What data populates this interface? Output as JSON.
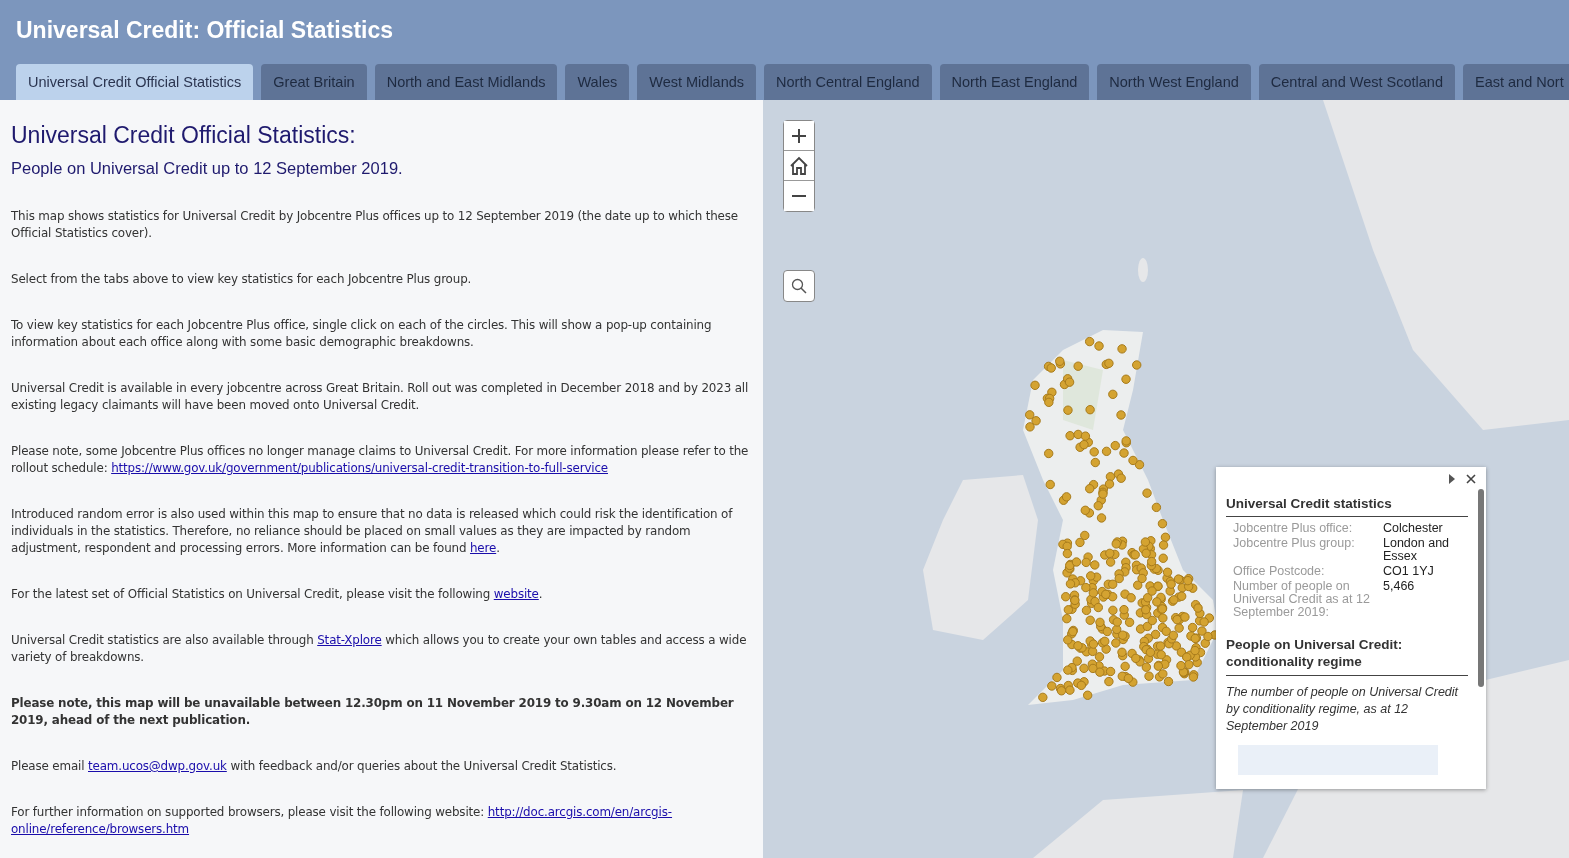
{
  "header": {
    "title": "Universal Credit: Official Statistics"
  },
  "tabs": [
    {
      "label": "Universal Credit Official Statistics",
      "selected": true
    },
    {
      "label": "Great Britain",
      "selected": false
    },
    {
      "label": "North and East Midlands",
      "selected": false
    },
    {
      "label": "Wales",
      "selected": false
    },
    {
      "label": "West Midlands",
      "selected": false
    },
    {
      "label": "North Central England",
      "selected": false
    },
    {
      "label": "North East England",
      "selected": false
    },
    {
      "label": "North West England",
      "selected": false
    },
    {
      "label": "Central and West Scotland",
      "selected": false
    },
    {
      "label": "East and Nort",
      "selected": false
    }
  ],
  "panel": {
    "heading": "Universal Credit Official Statistics:",
    "subheading": "People on Universal Credit up to 12 September 2019.",
    "paragraphs": [
      {
        "bold": false,
        "parts": [
          {
            "kind": "text",
            "text": "This map shows statistics for Universal Credit by Jobcentre Plus offices up to 12 September 2019 (the date up to which these Official Statistics cover)."
          }
        ]
      },
      {
        "bold": false,
        "parts": [
          {
            "kind": "text",
            "text": "Select from the tabs above to view key statistics for each Jobcentre Plus group."
          }
        ]
      },
      {
        "bold": false,
        "parts": [
          {
            "kind": "text",
            "text": "To view key statistics for each Jobcentre Plus office, single click on each of the circles. This will show a pop-up containing information about each office along with some basic demographic breakdowns."
          }
        ]
      },
      {
        "bold": false,
        "parts": [
          {
            "kind": "text",
            "text": "Universal Credit is available in every jobcentre across Great Britain. Roll out was completed in December 2018 and by 2023 all existing legacy claimants will have been moved onto Universal Credit."
          }
        ]
      },
      {
        "bold": false,
        "parts": [
          {
            "kind": "text",
            "text": "Please note, some Jobcentre Plus offices no longer manage claims to Universal Credit. For more information please refer to the rollout schedule: "
          },
          {
            "kind": "link",
            "text": "https://www.gov.uk/government/publications/universal-credit-transition-to-full-service"
          }
        ]
      },
      {
        "bold": false,
        "parts": [
          {
            "kind": "text",
            "text": "Introduced random error is also used within this map to ensure that no data is released which could risk the identification of individuals in the statistics. Therefore, no reliance should be placed on small values as they are impacted by random adjustment, respondent and processing errors. More information can be found "
          },
          {
            "kind": "link",
            "text": "here"
          },
          {
            "kind": "text",
            "text": "."
          }
        ]
      },
      {
        "bold": false,
        "parts": [
          {
            "kind": "text",
            "text": "For the latest set of Official Statistics on Universal Credit, please visit the following "
          },
          {
            "kind": "link",
            "text": "website"
          },
          {
            "kind": "text",
            "text": "."
          }
        ]
      },
      {
        "bold": false,
        "parts": [
          {
            "kind": "text",
            "text": "Universal Credit statistics are also available through "
          },
          {
            "kind": "link",
            "text": "Stat-Xplore"
          },
          {
            "kind": "text",
            "text": " which allows you to create your own tables and access a wide variety of breakdowns."
          }
        ]
      },
      {
        "bold": true,
        "parts": [
          {
            "kind": "text",
            "text": "Please note, this map will be unavailable between 12.30pm on 11 November 2019 to 9.30am on 12 November 2019, ahead of the next publication."
          }
        ]
      },
      {
        "bold": false,
        "parts": [
          {
            "kind": "text",
            "text": "Please email "
          },
          {
            "kind": "link",
            "text": "team.ucos@dwp.gov.uk"
          },
          {
            "kind": "text",
            "text": " with feedback and/or queries about the Universal Credit Statistics."
          }
        ]
      },
      {
        "bold": false,
        "parts": [
          {
            "kind": "text",
            "text": "For further information on supported browsers, please visit the following website: "
          },
          {
            "kind": "link",
            "text": "http://doc.arcgis.com/en/arcgis-"
          },
          {
            "kind": "link",
            "text": "online/reference/browsers.htm"
          }
        ]
      }
    ]
  },
  "popup": {
    "title": "Universal Credit statistics",
    "fields": [
      {
        "label": "Jobcentre Plus office:",
        "value": "Colchester"
      },
      {
        "label": "Jobcentre Plus group:",
        "value": "London and Essex"
      },
      {
        "label": "Office Postcode:",
        "value": "CO1 1YJ"
      },
      {
        "label": "Number of people on Universal Credit as at 12 September 2019:",
        "value": "5,466"
      }
    ],
    "section_title": "People on Universal Credit: conditionality regime",
    "section_text": "The number of people on Universal Credit by conditionality regime, as at 12 September 2019"
  }
}
